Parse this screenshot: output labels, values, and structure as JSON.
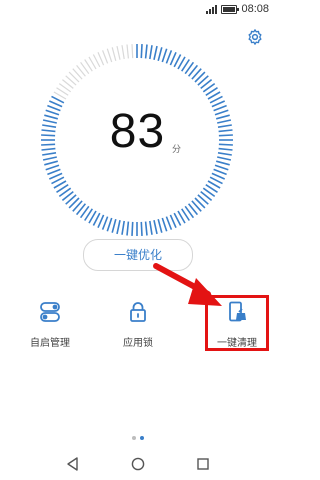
{
  "status_bar": {
    "time": "08:08"
  },
  "settings": {
    "icon": "gear-icon"
  },
  "gauge": {
    "score": "83",
    "unit": "分",
    "fill_fraction": 0.83,
    "accent": "#3a7fc9",
    "track": "#d9d9d9"
  },
  "optimize_button": {
    "label": "一键优化"
  },
  "tools": [
    {
      "label": "自启管理",
      "icon": "toggle-icon"
    },
    {
      "label": "应用锁",
      "icon": "lock-icon"
    },
    {
      "label": "一键清理",
      "icon": "phone-clean-icon"
    }
  ],
  "page_indicator": {
    "count": 2,
    "active": 1
  },
  "colors": {
    "accent": "#3a7fc9",
    "highlight": "#e31313"
  }
}
